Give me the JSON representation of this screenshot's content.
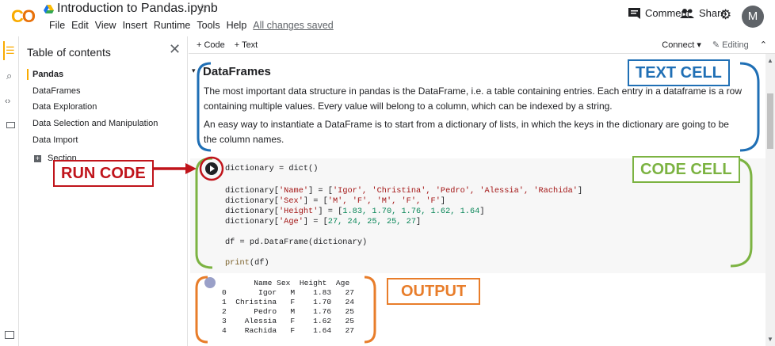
{
  "header": {
    "notebook_title": "Introduction to Pandas.ipynb",
    "menus": [
      "File",
      "Edit",
      "View",
      "Insert",
      "Runtime",
      "Tools",
      "Help"
    ],
    "save_status": "All changes saved",
    "comment_label": "Comment",
    "share_label": "Share",
    "avatar_letter": "M"
  },
  "toc": {
    "title": "Table of contents",
    "items": [
      "Pandas",
      "DataFrames",
      "Data Exploration",
      "Data Selection and Manipulation",
      "Data Import"
    ],
    "section_label": "Section"
  },
  "toolbar": {
    "add_code": "+ Code",
    "add_text": "+ Text",
    "connect": "Connect",
    "editing": "Editing"
  },
  "text_cell": {
    "heading": "DataFrames",
    "para1": "The most important data structure in pandas is the DataFrame, i.e. a table containing entries. Each entry in a dataframe is a row containing multiple values. Every value will belong to a column, which can be indexed by a string.",
    "para2": "An easy way to instantiate a DataFrame is to start from a dictionary of lists, in which the keys in the dictionary are going to be the column names."
  },
  "code_cell": {
    "line1": "dictionary = dict()",
    "name_key": "dictionary[",
    "name_str": "'Name'",
    "name_mid": "] = [",
    "name_vals": "'Igor', 'Christina', 'Pedro', 'Alessia', 'Rachida'",
    "name_end": "]",
    "sex_key": "dictionary[",
    "sex_str": "'Sex'",
    "sex_mid": "] = [",
    "sex_vals": "'M', 'F', 'M', 'F', 'F'",
    "sex_end": "]",
    "height_key": "dictionary[",
    "height_str": "'Height'",
    "height_mid": "] = [",
    "height_vals": "1.83, 1.70, 1.76, 1.62, 1.64",
    "height_end": "]",
    "age_key": "dictionary[",
    "age_str": "'Age'",
    "age_mid": "] = [",
    "age_vals": "27, 24, 25, 25, 27",
    "age_end": "]",
    "df_line": "df = pd.DataFrame(dictionary)",
    "print_fn": "print",
    "print_arg": "(df)"
  },
  "output": {
    "lines": [
      "       Name Sex  Height  Age",
      "0       Igor   M    1.83   27",
      "1  Christina   F    1.70   24",
      "2      Pedro   M    1.76   25",
      "3    Alessia   F    1.62   25",
      "4    Rachida   F    1.64   27"
    ]
  },
  "annotations": {
    "text_cell_label": "TEXT CELL",
    "code_cell_label": "CODE CELL",
    "output_label": "OUTPUT",
    "run_code_label": "RUN CODE",
    "colors": {
      "text": "#1f6fb5",
      "code": "#7cb342",
      "output": "#e87d2a",
      "run": "#c0141b"
    }
  }
}
